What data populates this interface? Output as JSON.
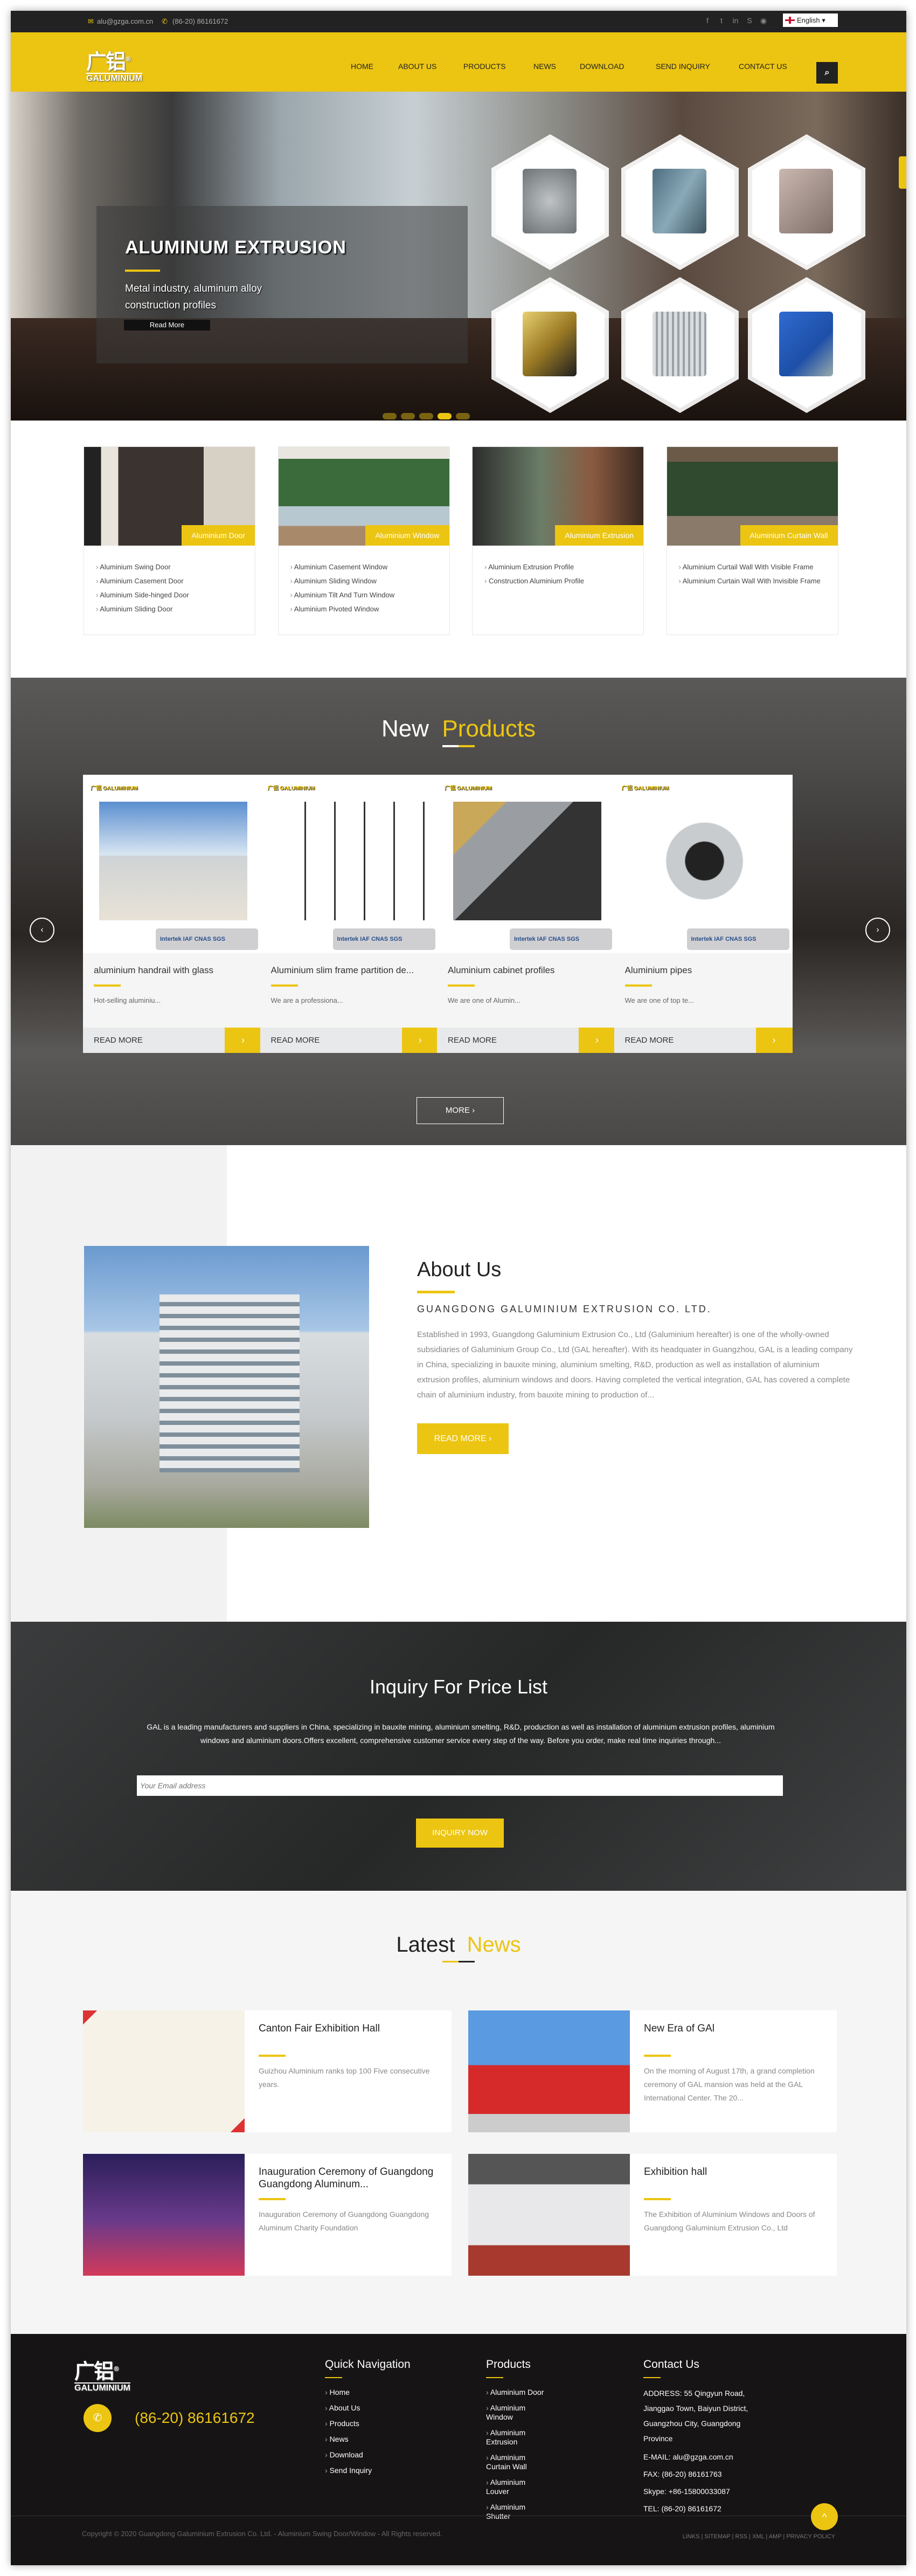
{
  "colors": {
    "accent": "#ecc512",
    "dark": "#222222",
    "footer": "#161414"
  },
  "topbar": {
    "email_icon": "envelope-icon",
    "email": "alu@gzga.com.cn",
    "phone_icon": "phone-icon",
    "phone": "(86-20)  86161672",
    "social": [
      "facebook-icon",
      "twitter-icon",
      "linkedin-icon",
      "skype-icon",
      "whatsapp-icon"
    ],
    "language": "English"
  },
  "brand": {
    "logo_cn": "广铝",
    "logo_en": "GALUMINIUM"
  },
  "header": {
    "nav": [
      "HOME",
      "ABOUT US",
      "PRODUCTS",
      "NEWS",
      "DOWNLOAD",
      "SEND INQUIRY",
      "CONTACT US"
    ],
    "search_icon": "search-icon"
  },
  "hero": {
    "title": "ALUMINUM EXTRUSION",
    "subtitle": "Metal industry, aluminum alloy construction profiles",
    "read_more": "Read More",
    "slides": 5,
    "active_slide": 4
  },
  "categories": [
    {
      "label": "Aluminium Door",
      "items": [
        "Aluminium Swing Door",
        "Aluminium Casement Door",
        "Aluminium Side-hinged Door",
        "Aluminium Sliding Door"
      ]
    },
    {
      "label": "Aluminium Window",
      "items": [
        "Aluminium Casement Window",
        "Aluminium Sliding Window",
        "Aluminium Tilt And Turn Window",
        "Aluminium Pivoted Window"
      ]
    },
    {
      "label": "Aluminium Extrusion",
      "items": [
        "Aluminium Extrusion Profile",
        "Construction Aluminium Profile"
      ]
    },
    {
      "label": "Aluminium Curtain Wall",
      "items": [
        "Aluminium Curtail Wall With Visible Frame",
        "Aluminium Curtain Wall With Invisible Frame"
      ]
    }
  ],
  "new_products": {
    "title_a": "New",
    "title_b": "Products",
    "badges": "Intertek  IAF  CNAS  SGS",
    "read_more": "READ MORE",
    "more": "MORE  ›",
    "items": [
      {
        "title": "aluminium handrail with glass",
        "desc": "Hot-selling aluminiu..."
      },
      {
        "title": "Aluminium slim frame partition de...",
        "desc": "We are a professiona..."
      },
      {
        "title": "Aluminium cabinet profiles",
        "desc": "We are one of Alumin..."
      },
      {
        "title": "Aluminium pipes",
        "desc": "We are one of top te..."
      }
    ]
  },
  "about": {
    "title": "About Us",
    "company": "GUANGDONG GALUMINIUM EXTRUSION CO. LTD.",
    "text": "Established in 1993, Guangdong Galuminium Extrusion Co., Ltd (Galuminium hereafter) is one of the wholly-owned subsidiaries of Galuminium Group Co., Ltd (GAL hereafter). With its headquater in Guangzhou, GAL is a leading company in China, specializing in bauxite mining, aluminium smelting, R&D, production as well as installation of aluminium extrusion profiles, aluminium windows and doors. Having completed the vertical integration, GAL has covered a complete chain of aluminium industry, from bauxite mining to production of...",
    "button": "READ MORE  ›"
  },
  "inquiry": {
    "title": "Inquiry For Price List",
    "text": "GAL is a leading manufacturers and suppliers in China, specializing in bauxite mining, aluminium smelting, R&D, production as well as installation of aluminium extrusion profiles, aluminium windows and aluminium doors.Offers excellent, comprehensive customer service every step of the way. Before you order, make real time inquiries through...",
    "placeholder": "Your Email address",
    "button": "INQUIRY NOW"
  },
  "news": {
    "title_a": "Latest",
    "title_b": "News",
    "items": [
      {
        "title": "Canton Fair Exhibition Hall",
        "desc": "Guizhou Aluminium ranks top 100 Five consecutive years."
      },
      {
        "title": "New Era of GAl",
        "desc": "On the morning of August 17th, a grand completion ceremony of GAL mansion was held at the GAL International Center. The 20..."
      },
      {
        "title": "Inauguration Ceremony of Guangdong Guangdong Aluminum...",
        "desc": "Inauguration Ceremony of Guangdong Guangdong Aluminum Charity Foundation"
      },
      {
        "title": "Exhibition hall",
        "desc": "The Exhibition of Aluminium Windows and Doors of Guangdong Galuminium Extrusion Co., Ltd"
      }
    ]
  },
  "footer": {
    "phone": "(86-20)  86161672",
    "quick_nav": {
      "title": "Quick Navigation",
      "items": [
        "Home",
        "About Us",
        "Products",
        "News",
        "Download",
        "Send Inquiry"
      ]
    },
    "products": {
      "title": "Products",
      "items": [
        "Aluminium Door",
        "Aluminium Window",
        "Aluminium Extrusion",
        "Aluminium Curtain Wall",
        "Aluminium Louver",
        "Aluminium Shutter"
      ]
    },
    "contact": {
      "title": "Contact Us",
      "address": "ADDRESS: 55 Qingyun Road, Jianggao Town, Baiyun District, Guangzhou City, Guangdong Province",
      "email": "E-MAIL: alu@gzga.com.cn",
      "fax": "FAX:  (86-20)  86161763",
      "skype": "Skype: +86-15800033087",
      "tel": "TEL:  (86-20)  86161672"
    },
    "copyright": "Copyright © 2020 Guangdong Galuminium Extrusion Co. Ltd. - Aluminium Swing Door/Window - All Rights reserved.",
    "links": [
      "LINKS",
      "SITEMAP",
      "RSS",
      "XML",
      "AMP",
      "PRIVACY POLICY"
    ]
  }
}
